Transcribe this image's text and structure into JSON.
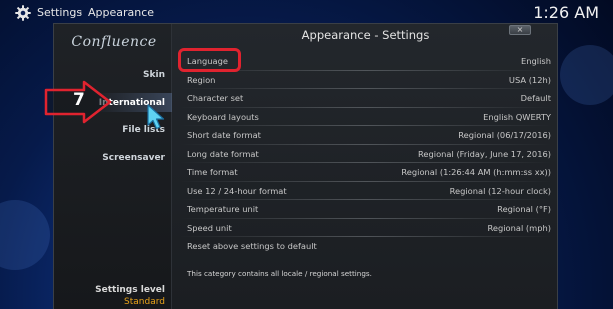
{
  "topbar": {
    "app_title": "Settings",
    "separator": "·",
    "page_title": "Appearance",
    "clock": "1:26 AM"
  },
  "sidebar": {
    "logo": "Confluence",
    "items": [
      {
        "label": "Skin"
      },
      {
        "label": "International"
      },
      {
        "label": "File lists"
      },
      {
        "label": "Screensaver"
      }
    ],
    "settings_level_label": "Settings level",
    "settings_level_value": "Standard"
  },
  "window": {
    "title": "Appearance - Settings",
    "close_label": "×"
  },
  "settings": [
    {
      "label": "Language",
      "value": "English"
    },
    {
      "label": "Region",
      "value": "USA (12h)"
    },
    {
      "label": "Character set",
      "value": "Default"
    },
    {
      "label": "Keyboard layouts",
      "value": "English QWERTY"
    },
    {
      "label": "Short date format",
      "value": "Regional (06/17/2016)"
    },
    {
      "label": "Long date format",
      "value": "Regional (Friday, June 17, 2016)"
    },
    {
      "label": "Time format",
      "value": "Regional (1:26:44 AM (h:mm:ss xx))"
    },
    {
      "label": "Use 12 / 24-hour format",
      "value": "Regional (12-hour clock)"
    },
    {
      "label": "Temperature unit",
      "value": "Regional (°F)"
    },
    {
      "label": "Speed unit",
      "value": "Regional (mph)"
    },
    {
      "label": "Reset above settings to default",
      "value": ""
    }
  ],
  "footer_note": "This category contains all locale / regional settings.",
  "annotation": {
    "step_number": "7",
    "highlight_color": "#e0232f"
  },
  "icons": {
    "app": "gear-icon",
    "pointer": "cursor-icon"
  }
}
